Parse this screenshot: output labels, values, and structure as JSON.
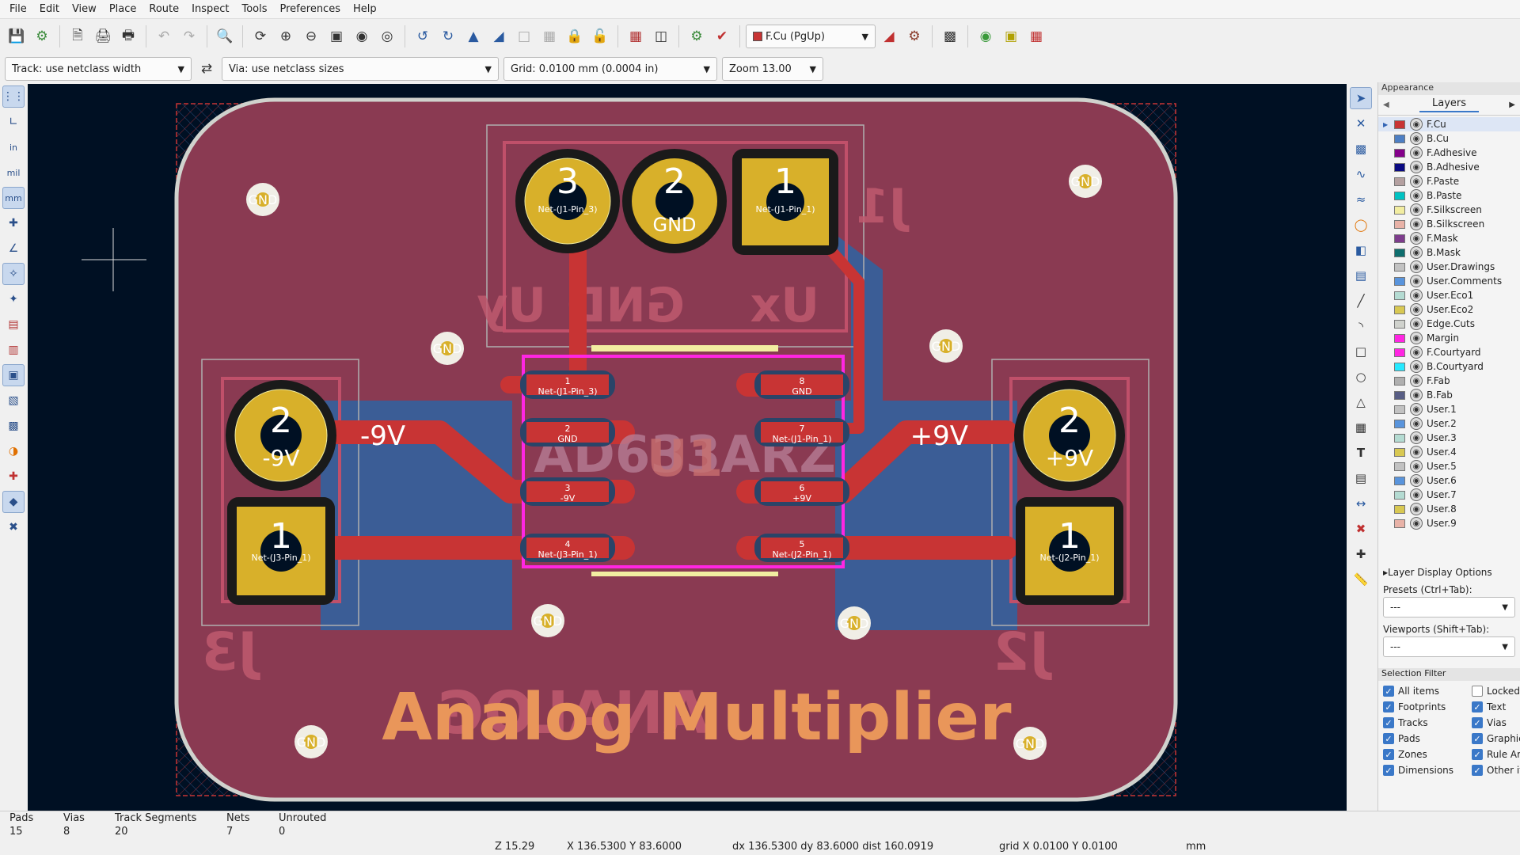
{
  "menu": [
    "File",
    "Edit",
    "View",
    "Place",
    "Route",
    "Inspect",
    "Tools",
    "Preferences",
    "Help"
  ],
  "toolbar": {
    "layer_select": "F.Cu (PgUp)"
  },
  "toolbar2": {
    "track": "Track: use netclass width",
    "via": "Via: use netclass sizes",
    "grid": "Grid: 0.0100 mm (0.0004 in)",
    "zoom": "Zoom 13.00"
  },
  "left_tools": {
    "in": "in",
    "mil": "mil",
    "mm": "mm"
  },
  "board": {
    "title_text": "Analog Multiplier",
    "silkscreen_back": [
      "J1",
      "Ux",
      "GND",
      "Uy",
      "J3",
      "J2",
      "ANALOG",
      "AD633ARZ",
      "U1"
    ],
    "via_label": "GND",
    "connectors": {
      "J1": {
        "pins": [
          "3",
          "2",
          "1"
        ],
        "nets": [
          "Net-(J1-Pin_3)",
          "GND",
          "Net-(J1-Pin_1)"
        ]
      },
      "J3": {
        "pins": [
          "2",
          "1"
        ],
        "nets": [
          "-9V",
          "Net-(J3-Pin_1)"
        ]
      },
      "J2": {
        "pins": [
          "2",
          "1"
        ],
        "nets": [
          "+9V",
          "Net-(J2-Pin_1)"
        ]
      }
    },
    "power_labels": {
      "neg": "-9V",
      "pos": "+9V"
    },
    "ic_pads": [
      {
        "num": "1",
        "net": "Net-(J1-Pin_3)"
      },
      {
        "num": "2",
        "net": "GND"
      },
      {
        "num": "3",
        "net": "-9V"
      },
      {
        "num": "4",
        "net": "Net-(J3-Pin_1)"
      },
      {
        "num": "8",
        "net": "GND"
      },
      {
        "num": "7",
        "net": "Net-(J1-Pin_1)"
      },
      {
        "num": "6",
        "net": "+9V"
      },
      {
        "num": "5",
        "net": "Net-(J2-Pin_1)"
      }
    ]
  },
  "panel": {
    "title": "Appearance",
    "tab": "Layers",
    "layers": [
      {
        "name": "F.Cu",
        "color": "#c83434"
      },
      {
        "name": "B.Cu",
        "color": "#4d7fc4"
      },
      {
        "name": "F.Adhesive",
        "color": "#84008a"
      },
      {
        "name": "B.Adhesive",
        "color": "#0a0a82"
      },
      {
        "name": "F.Paste",
        "color": "#b4a0a0"
      },
      {
        "name": "B.Paste",
        "color": "#00c2c2"
      },
      {
        "name": "F.Silkscreen",
        "color": "#f2eda1"
      },
      {
        "name": "B.Silkscreen",
        "color": "#e8b2a7"
      },
      {
        "name": "F.Mask",
        "color": "#7d3c8c"
      },
      {
        "name": "B.Mask",
        "color": "#0e6e6e"
      },
      {
        "name": "User.Drawings",
        "color": "#c2c2c2"
      },
      {
        "name": "User.Comments",
        "color": "#5994dc"
      },
      {
        "name": "User.Eco1",
        "color": "#b4dbd2"
      },
      {
        "name": "User.Eco2",
        "color": "#d8c852"
      },
      {
        "name": "Edge.Cuts",
        "color": "#d0d2cd"
      },
      {
        "name": "Margin",
        "color": "#ff26e2"
      },
      {
        "name": "F.Courtyard",
        "color": "#ff26e2"
      },
      {
        "name": "B.Courtyard",
        "color": "#26e9ff"
      },
      {
        "name": "F.Fab",
        "color": "#afafaf"
      },
      {
        "name": "B.Fab",
        "color": "#585d84"
      },
      {
        "name": "User.1",
        "color": "#c2c2c2"
      },
      {
        "name": "User.2",
        "color": "#5994dc"
      },
      {
        "name": "User.3",
        "color": "#b4dbd2"
      },
      {
        "name": "User.4",
        "color": "#d8c852"
      },
      {
        "name": "User.5",
        "color": "#c2c2c2"
      },
      {
        "name": "User.6",
        "color": "#5994dc"
      },
      {
        "name": "User.7",
        "color": "#b4dbd2"
      },
      {
        "name": "User.8",
        "color": "#d8c852"
      },
      {
        "name": "User.9",
        "color": "#e8b2a7"
      }
    ],
    "layer_display_options": "Layer Display Options",
    "presets_label": "Presets (Ctrl+Tab):",
    "presets_value": "---",
    "viewports_label": "Viewports (Shift+Tab):",
    "viewports_value": "---",
    "selection_filter": "Selection Filter",
    "filters": [
      {
        "label": "All items",
        "checked": true
      },
      {
        "label": "Locked",
        "checked": false
      },
      {
        "label": "Footprints",
        "checked": true
      },
      {
        "label": "Text",
        "checked": true
      },
      {
        "label": "Tracks",
        "checked": true
      },
      {
        "label": "Vias",
        "checked": true
      },
      {
        "label": "Pads",
        "checked": true
      },
      {
        "label": "Graphic",
        "checked": true
      },
      {
        "label": "Zones",
        "checked": true
      },
      {
        "label": "Rule Ar",
        "checked": true
      },
      {
        "label": "Dimensions",
        "checked": true
      },
      {
        "label": "Other it",
        "checked": true
      }
    ]
  },
  "messages": {
    "pads_label": "Pads",
    "pads": "15",
    "vias_label": "Vias",
    "vias": "8",
    "tracks_label": "Track Segments",
    "tracks": "20",
    "nets_label": "Nets",
    "nets": "7",
    "unrouted_label": "Unrouted",
    "unrouted": "0"
  },
  "status": {
    "zoom": "Z 15.29",
    "xy": "X 136.5300  Y 83.6000",
    "delta": "dx 136.5300  dy 83.6000  dist 160.0919",
    "grid": "grid X 0.0100  Y 0.0100",
    "units": "mm"
  }
}
